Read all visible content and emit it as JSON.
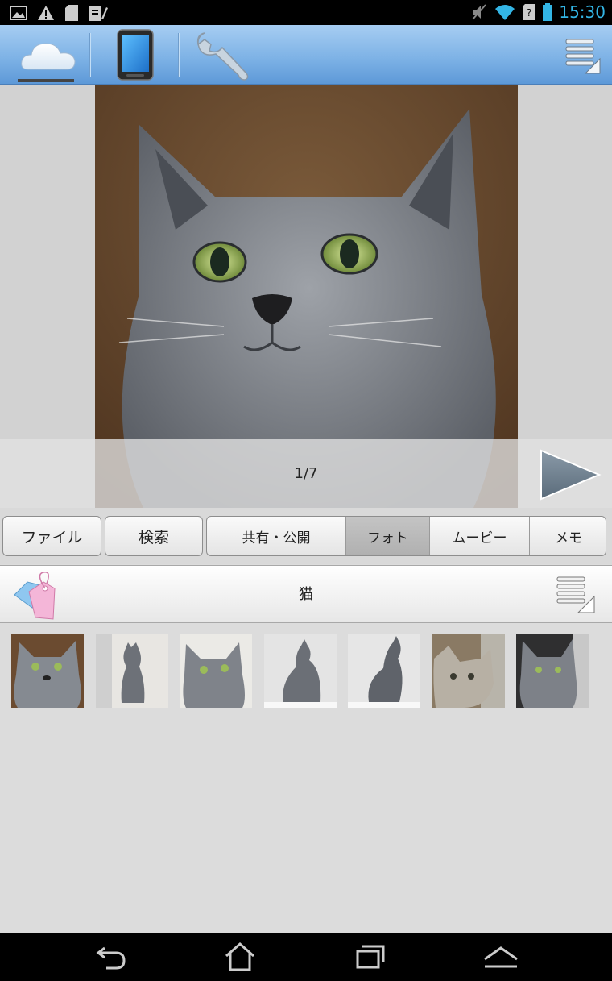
{
  "status_bar": {
    "left_icons": [
      "image-notification-icon",
      "warning-icon",
      "sd-card-icon",
      "clipboard-edit-icon"
    ],
    "right_icons": [
      "mute-icon",
      "wifi-icon",
      "no-sim-icon",
      "battery-icon"
    ],
    "time": "15:30"
  },
  "toolbar": {
    "buttons": [
      {
        "name": "cloud-tab",
        "icon": "cloud-icon",
        "selected": true
      },
      {
        "name": "device-tab",
        "icon": "tablet-icon",
        "selected": false
      },
      {
        "name": "settings-tab",
        "icon": "wrench-icon",
        "selected": false
      }
    ],
    "menu_icon": "menu-icon"
  },
  "viewer": {
    "page_counter": "1/7",
    "play_icon": "play-icon"
  },
  "tabs": {
    "file": "ファイル",
    "search": "検索",
    "share": "共有・公開",
    "photo": "フォト",
    "movie": "ムービー",
    "memo": "メモ",
    "active": "photo"
  },
  "tag_bar": {
    "title": "猫",
    "tag_icon": "tag-icon",
    "menu_icon": "menu-icon"
  },
  "thumbnails": {
    "count": 7
  },
  "nav_bar": {
    "icons": [
      "back-icon",
      "home-icon",
      "recent-apps-icon",
      "menu-up-icon"
    ]
  },
  "colors": {
    "clock": "#33b5e5",
    "toolbar_top": "#a6cdf2",
    "toolbar_bottom": "#5d99d8"
  }
}
